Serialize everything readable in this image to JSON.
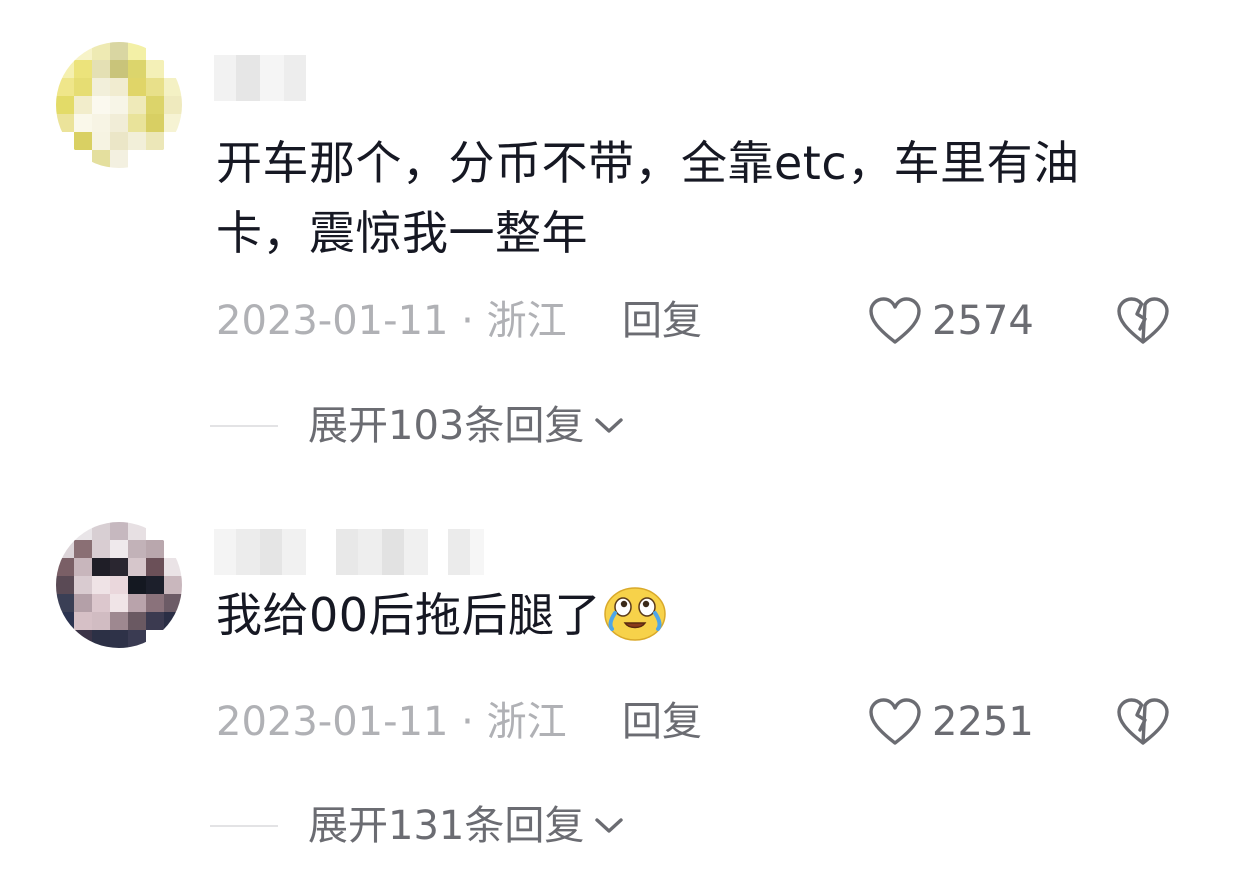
{
  "comments": [
    {
      "text": "开车那个，分币不带，全靠etc，车里有油\n卡，震惊我一整年",
      "date_location": "2023-01-11 · 浙江",
      "reply_label": "回复",
      "like_count": "2574",
      "expand_label": "展开103条回复"
    },
    {
      "text": "我给00后拖后腿了",
      "emoji": "crying-laughing-face-icon",
      "date_location": "2023-01-11 · 浙江",
      "reply_label": "回复",
      "like_count": "2251",
      "expand_label": "展开131条回复"
    }
  ],
  "colors": {
    "text_primary": "#161823",
    "text_meta": "#b0b1b5",
    "text_secondary": "#6b6c72",
    "divider": "#e3e3e5"
  },
  "icons": {
    "like": "heart-outline-icon",
    "dislike": "broken-heart-icon",
    "expand": "chevron-down-icon"
  }
}
